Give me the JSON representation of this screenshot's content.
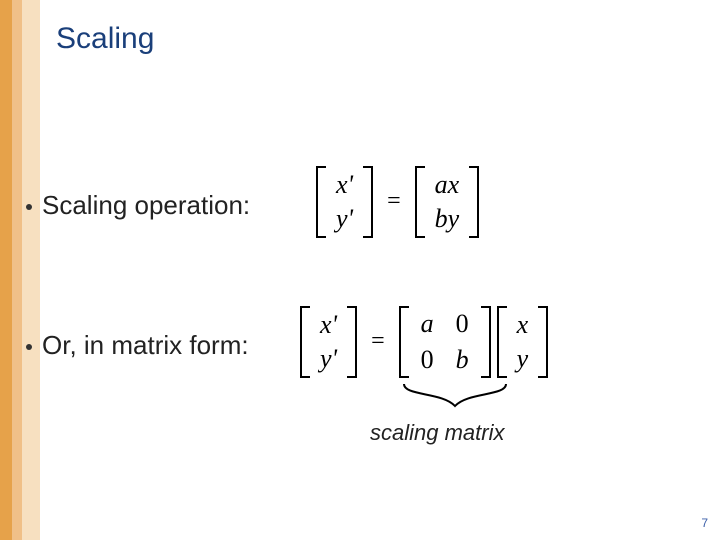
{
  "title": "Scaling",
  "bullets": {
    "b1": "Scaling operation:",
    "b2": "Or, in matrix form:"
  },
  "eq1": {
    "lhs": {
      "r1": "x'",
      "r2": "y'"
    },
    "sign": "=",
    "rhs": {
      "r1": "ax",
      "r2": "by"
    }
  },
  "eq2": {
    "lhs": {
      "r1": "x'",
      "r2": "y'"
    },
    "sign": "=",
    "mat": {
      "m11": "a",
      "m12": "0",
      "m21": "0",
      "m22": "b"
    },
    "vec": {
      "r1": "x",
      "r2": "y"
    }
  },
  "annotation": "scaling matrix",
  "page": "7"
}
